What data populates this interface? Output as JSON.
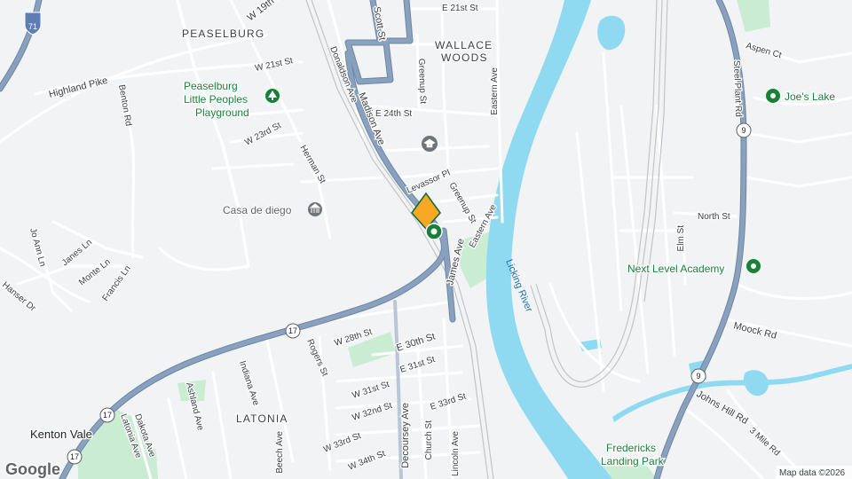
{
  "map": {
    "colors": {
      "land": "#f1f3f4",
      "water": "#8fdaf0",
      "park": "#c9ecd3",
      "arterial": "#8aa1bd",
      "arterial_edge": "#6d86a6",
      "minor_road": "#ffffff",
      "minor_edge": "#d6dade",
      "rail": "#bdbdbd",
      "poi_green": "#188038",
      "poi_gray": "#70757a",
      "pin": "#f9a825",
      "pin_edge": "#0b6b32"
    },
    "neighborhoods": [
      {
        "id": "peaselburg",
        "text": "PEASELBURG"
      },
      {
        "id": "wallace",
        "text": "WALLACE"
      },
      {
        "id": "woods",
        "text": "WOODS"
      },
      {
        "id": "latonia",
        "text": "LATONIA"
      },
      {
        "id": "kenton-vale",
        "text": "Kenton Vale"
      }
    ],
    "water_labels": [
      {
        "id": "licking-river",
        "text": "Licking River"
      }
    ],
    "pois": [
      {
        "id": "playground-1",
        "text": "Peaselburg",
        "icon": "tree-icon"
      },
      {
        "id": "playground-2",
        "text": "Little Peoples"
      },
      {
        "id": "playground-3",
        "text": "Playground"
      },
      {
        "id": "casa",
        "text": "Casa de diego",
        "icon": "museum-icon"
      },
      {
        "id": "joes-lake",
        "text": "Joe's Lake",
        "icon": "park-icon"
      },
      {
        "id": "next-level",
        "text": "Next Level Academy",
        "icon": "park-icon"
      },
      {
        "id": "fredericks-1",
        "text": "Fredericks"
      },
      {
        "id": "fredericks-2",
        "text": "Landing Park"
      },
      {
        "id": "school",
        "text": "",
        "icon": "school-icon"
      }
    ],
    "streets": [
      {
        "id": "w19th",
        "text": "W 19th St"
      },
      {
        "id": "e21st",
        "text": "E 21st St"
      },
      {
        "id": "scott",
        "text": "Scott St"
      },
      {
        "id": "highland",
        "text": "Highland Pike"
      },
      {
        "id": "benton",
        "text": "Benton Rd"
      },
      {
        "id": "w21st",
        "text": "W 21st St"
      },
      {
        "id": "donaldson",
        "text": "Donaldson Ave"
      },
      {
        "id": "madison",
        "text": "Madison Ave"
      },
      {
        "id": "greenup-top",
        "text": "Greenup St"
      },
      {
        "id": "eastern-top",
        "text": "Eastern Ave"
      },
      {
        "id": "e24th",
        "text": "E 24th St"
      },
      {
        "id": "w23rd",
        "text": "W 23rd St"
      },
      {
        "id": "herman",
        "text": "Herman St"
      },
      {
        "id": "levassor",
        "text": "Levassor Pl"
      },
      {
        "id": "greenup-mid",
        "text": "Greenup St"
      },
      {
        "id": "eastern-mid",
        "text": "Eastern Ave"
      },
      {
        "id": "james",
        "text": "James Ave"
      },
      {
        "id": "joann",
        "text": "Jo Ann Ln"
      },
      {
        "id": "janes",
        "text": "Janes Ln"
      },
      {
        "id": "monte",
        "text": "Monte Ln"
      },
      {
        "id": "francis",
        "text": "Francis Ln"
      },
      {
        "id": "hanser",
        "text": "Hanser Dr"
      },
      {
        "id": "w28th",
        "text": "W 28th St"
      },
      {
        "id": "e30th",
        "text": "E 30th St"
      },
      {
        "id": "e31st",
        "text": "E 31st St"
      },
      {
        "id": "w31st",
        "text": "W 31st St"
      },
      {
        "id": "w32nd",
        "text": "W 32nd St"
      },
      {
        "id": "e33rd",
        "text": "E 33rd St"
      },
      {
        "id": "w33rd",
        "text": "W 33rd St"
      },
      {
        "id": "w34th",
        "text": "W 34th St"
      },
      {
        "id": "rogers",
        "text": "Rogers St"
      },
      {
        "id": "indiana",
        "text": "Indiana Ave"
      },
      {
        "id": "ashland",
        "text": "Ashland Ave"
      },
      {
        "id": "dakota",
        "text": "Dakota Ave"
      },
      {
        "id": "latonia-ave",
        "text": "Latonia Ave"
      },
      {
        "id": "beech",
        "text": "Beech Ave"
      },
      {
        "id": "decoursey",
        "text": "Decoursey Ave"
      },
      {
        "id": "church",
        "text": "Church St"
      },
      {
        "id": "lincoln",
        "text": "Lincoln Ave"
      },
      {
        "id": "aspen",
        "text": "Aspen Ct"
      },
      {
        "id": "steel-plant",
        "text": "Steel Plant Rd"
      },
      {
        "id": "north",
        "text": "North St"
      },
      {
        "id": "elm",
        "text": "Elm St"
      },
      {
        "id": "moock",
        "text": "Moock Rd"
      },
      {
        "id": "johns-hill",
        "text": "Johns Hill Rd"
      },
      {
        "id": "3mile",
        "text": "3 Mile Rd"
      }
    ],
    "route_shields": [
      {
        "id": "i71",
        "text": "71"
      },
      {
        "id": "r9a",
        "text": "9"
      },
      {
        "id": "r9b",
        "text": "9"
      },
      {
        "id": "r17a",
        "text": "17"
      },
      {
        "id": "r17b",
        "text": "17"
      },
      {
        "id": "r17c",
        "text": "17"
      }
    ],
    "attribution": "Map data ©2026",
    "logo": "Google"
  }
}
